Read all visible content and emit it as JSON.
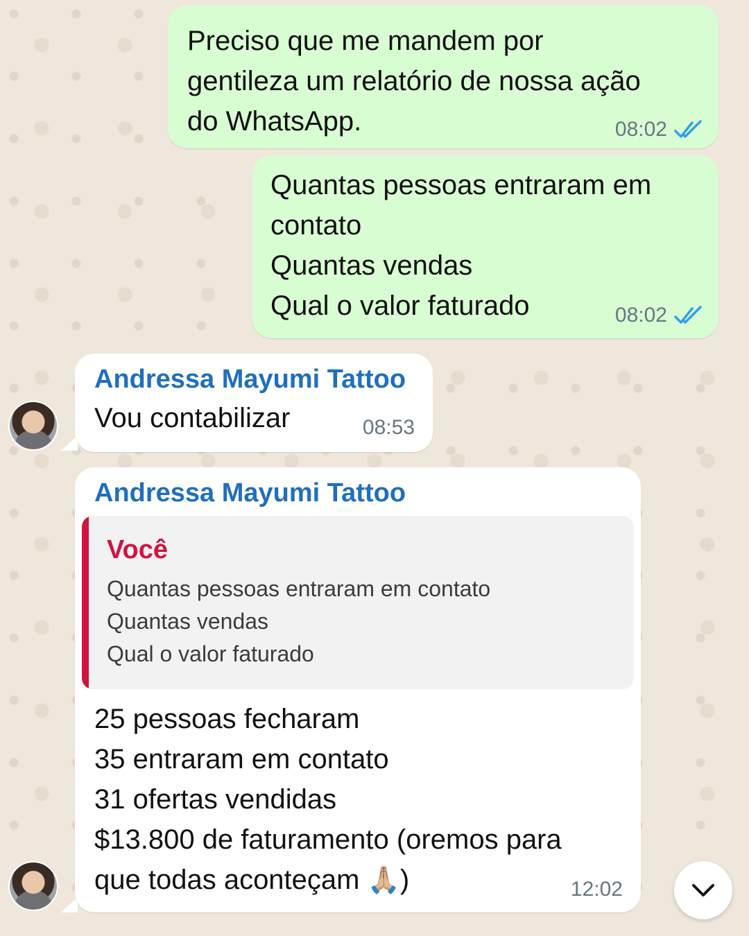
{
  "messages": [
    {
      "direction": "outgoing",
      "text": "Preciso que me mandem por\ngentileza um relatório de nossa ação\ndo WhatsApp.",
      "time": "08:02",
      "status": "read"
    },
    {
      "direction": "outgoing",
      "text": "Quantas pessoas entraram em\ncontato\nQuantas vendas\nQual o valor faturado",
      "time": "08:02",
      "status": "read"
    },
    {
      "direction": "incoming",
      "sender": "Andressa Mayumi Tattoo",
      "text": "Vou contabilizar",
      "time": "08:53"
    },
    {
      "direction": "incoming",
      "sender": "Andressa Mayumi Tattoo",
      "quote": {
        "author": "Você",
        "text": "Quantas pessoas entraram em contato\nQuantas vendas\nQual o valor faturado"
      },
      "text": "25 pessoas fecharam\n35 entraram em contato\n31 ofertas vendidas\n$13.800 de faturamento (oremos para\nque todas aconteçam ",
      "emoji": "🙏🏼",
      "text_end": ")",
      "time": "12:02"
    }
  ],
  "colors": {
    "outgoing_bubble": "#d9fdd3",
    "incoming_bubble": "#ffffff",
    "sender_name": "#1f6fbf",
    "quote_author": "#d0143f",
    "read_ticks": "#34a0e8"
  },
  "icons": {
    "read_status": "double-check-icon",
    "scroll_down": "chevron-down-icon"
  }
}
